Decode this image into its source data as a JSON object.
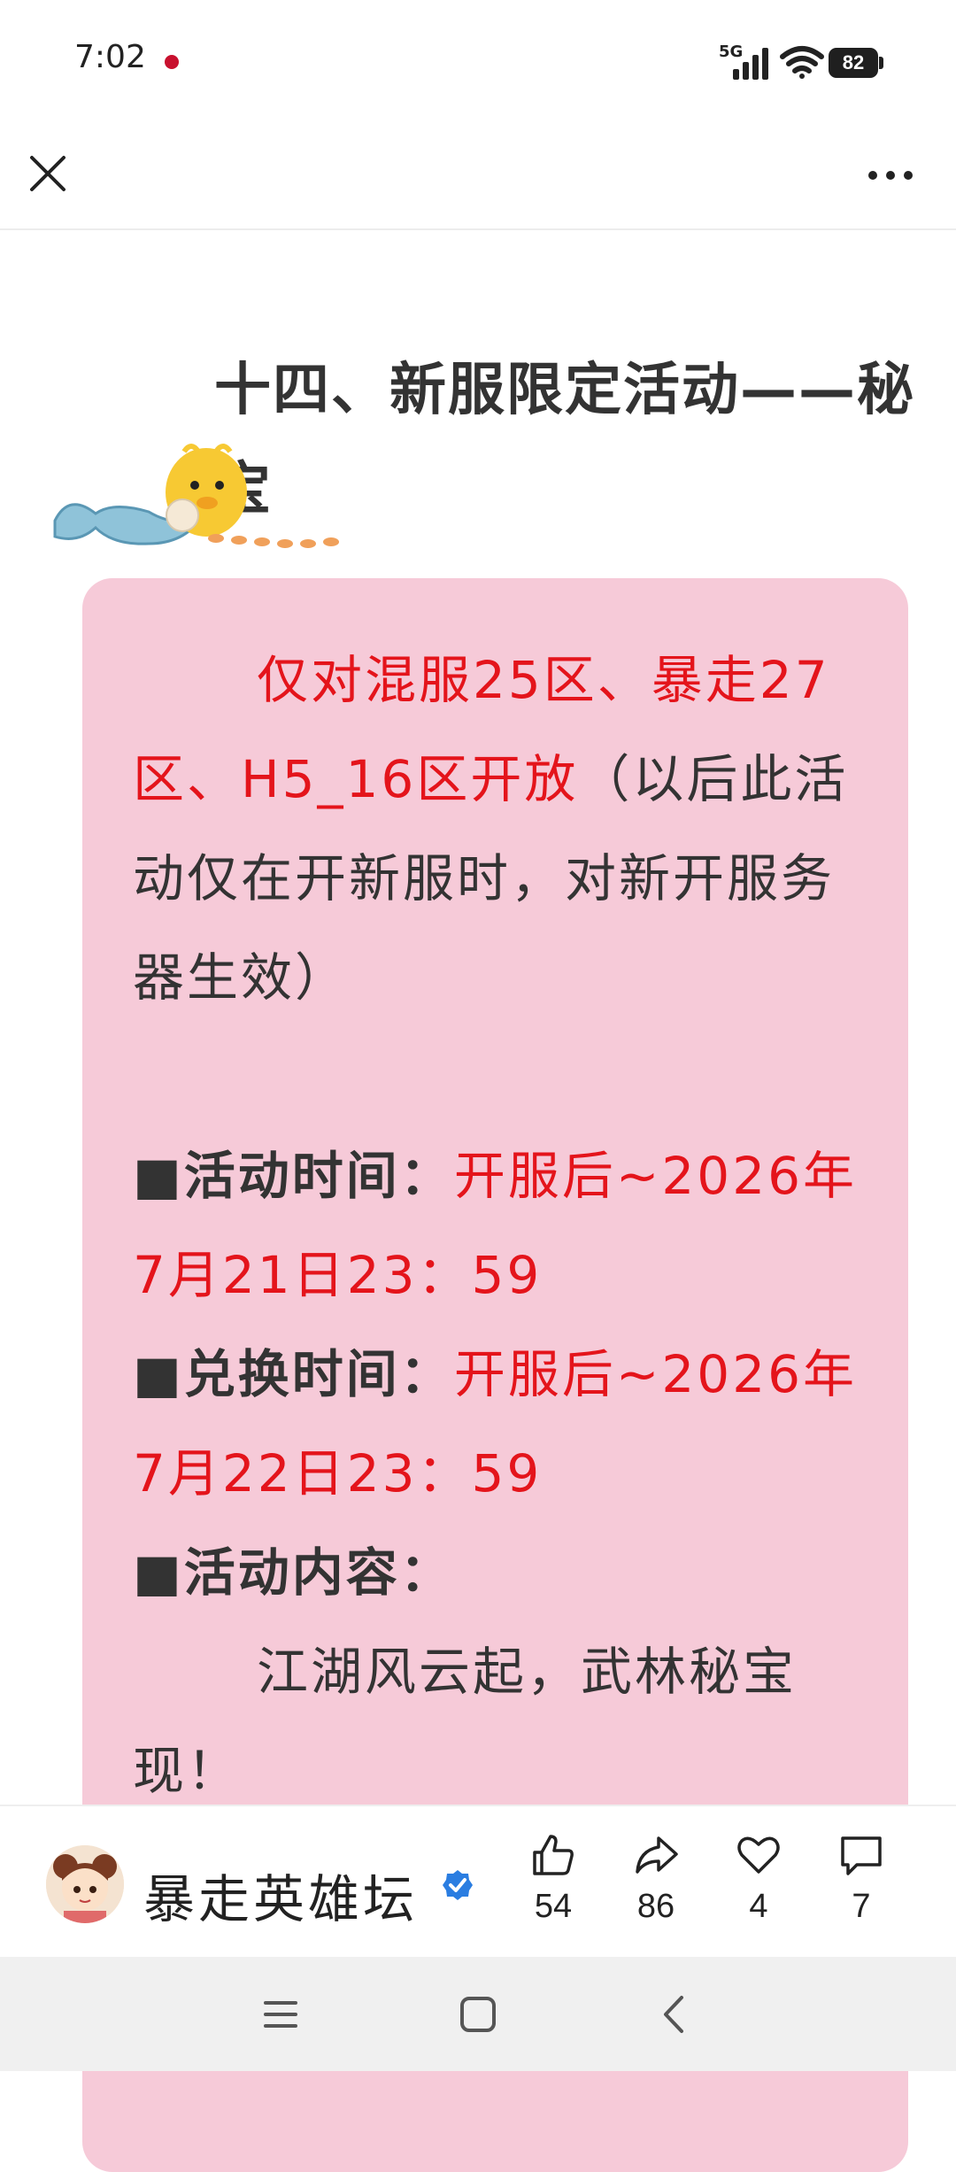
{
  "status": {
    "time": "7:02",
    "network": "5G",
    "battery": "82"
  },
  "article": {
    "heading": "十四、新服限定活动——秘宝",
    "para1_red": "仅对混服25区、暴走27区、H5_16区开放",
    "para1_rest": "（以后此活动仅在开新服时，对新开服务器生效）",
    "time_label": "■活动时间：",
    "time_value": "开服后~2026年7月21日23：59",
    "exchange_label": "■兑换时间：",
    "exchange_value": "开服后~2026年7月22日23：59",
    "content_label": "■活动内容：",
    "content_text": "江湖风云起，武林秘宝现！"
  },
  "footer": {
    "author": "暴走英雄坛",
    "likes": "54",
    "shares": "86",
    "favorites": "4",
    "comments": "7"
  },
  "colors": {
    "card_bg": "#f6cad8",
    "highlight_red": "#e4141b",
    "verified_blue": "#2a7de1"
  }
}
